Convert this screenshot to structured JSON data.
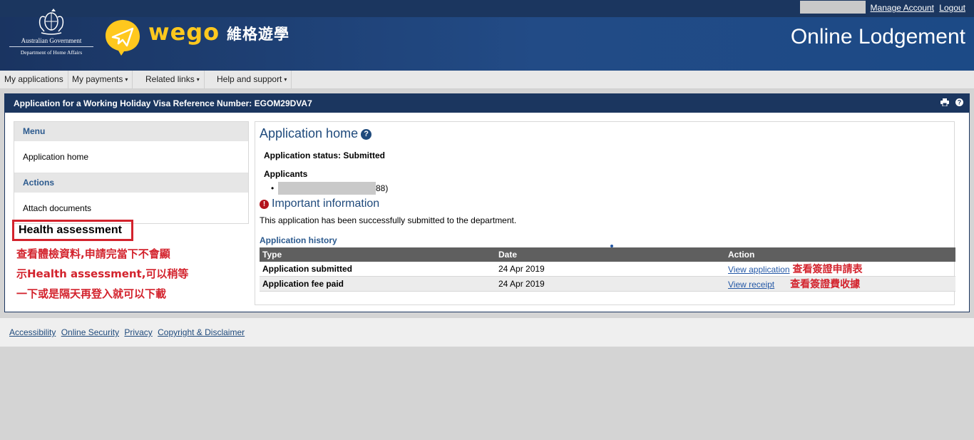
{
  "header": {
    "gov_line1": "Australian Government",
    "gov_line2": "Department of Home Affairs",
    "brand": "wego",
    "brand_cjk": "維格遊學",
    "title": "Online Lodgement",
    "manage_account": "Manage Account",
    "logout": "Logout"
  },
  "nav": {
    "items": [
      {
        "label": "My applications"
      },
      {
        "label": "My payments"
      },
      {
        "label": "Related links"
      },
      {
        "label": "Help and support"
      }
    ],
    "caret": "▾"
  },
  "frame": {
    "title": "Application for a Working Holiday Visa Reference Number: EGOM29DVA7",
    "print_icon": "print-icon",
    "help_icon": "help-icon"
  },
  "menu": {
    "section_menu": "Menu",
    "item_home": "Application home",
    "section_actions": "Actions",
    "item_attach": "Attach documents"
  },
  "annotation": {
    "health": "Health assessment",
    "note_line1": "查看體檢資料,申請完當下不會顯",
    "note_line2": "示Health assessment,可以稍等",
    "note_line3": "一下或是隔天再登入就可以下載"
  },
  "content": {
    "title": "Application home",
    "status": "Application status: Submitted",
    "applicants_label": "Applicants",
    "applicant_suffix": "88)",
    "important_title": "Important information",
    "success_msg": "This application has been successfully submitted to the department.",
    "history_label": "Application history",
    "table": {
      "headers": [
        "Type",
        "Date",
        "Action"
      ],
      "rows": [
        {
          "type": "Application submitted",
          "date": "24 Apr 2019",
          "action": "View application",
          "note": "查看簽證申請表"
        },
        {
          "type": "Application fee paid",
          "date": "24 Apr 2019",
          "action": "View receipt",
          "note": "查看簽證費收據"
        }
      ]
    }
  },
  "footer": {
    "links": [
      "Accessibility",
      "Online Security",
      "Privacy",
      "Copyright & Disclaimer"
    ]
  },
  "colors": {
    "header_navy": "#1b365f",
    "brand_yellow": "#ffc81e",
    "annotation_red": "#d3232d",
    "link_blue": "#2458a6"
  }
}
